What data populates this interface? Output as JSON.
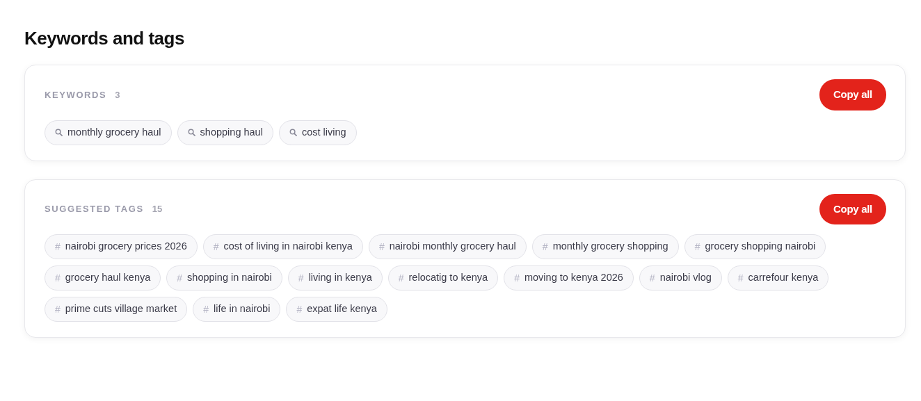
{
  "heading": "Keywords and tags",
  "sections": [
    {
      "title": "KEYWORDS",
      "count": "3",
      "button": "Copy all",
      "items": [
        {
          "kind": "search",
          "text": "monthly grocery haul"
        },
        {
          "kind": "search",
          "text": "shopping haul"
        },
        {
          "kind": "search",
          "text": "cost living"
        }
      ]
    },
    {
      "title": "SUGGESTED TAGS",
      "count": "15",
      "button": "Copy all",
      "items": [
        {
          "kind": "hash",
          "mark": "#",
          "text": "nairobi grocery prices 2026"
        },
        {
          "kind": "hash",
          "mark": "#",
          "text": "cost of living in nairobi kenya"
        },
        {
          "kind": "hash",
          "mark": "#",
          "text": "nairobi monthly grocery haul"
        },
        {
          "kind": "hash",
          "mark": "#",
          "text": "monthly grocery shopping"
        },
        {
          "kind": "hash",
          "mark": "#",
          "text": "grocery shopping nairobi"
        },
        {
          "kind": "hash",
          "mark": "#",
          "text": "grocery haul kenya"
        },
        {
          "kind": "hash",
          "mark": "#",
          "text": "shopping in nairobi"
        },
        {
          "kind": "hash",
          "mark": "#",
          "text": "living in kenya"
        },
        {
          "kind": "hash",
          "mark": "#",
          "text": "relocatig to kenya"
        },
        {
          "kind": "hash",
          "mark": "#",
          "text": "moving to kenya 2026"
        },
        {
          "kind": "hash",
          "mark": "#",
          "text": "nairobi vlog"
        },
        {
          "kind": "hash",
          "mark": "#",
          "text": "carrefour kenya"
        },
        {
          "kind": "hash",
          "mark": "#",
          "text": "prime cuts village market"
        },
        {
          "kind": "hash",
          "mark": "#",
          "text": "life in nairobi"
        },
        {
          "kind": "hash",
          "mark": "#",
          "text": "expat life kenya"
        }
      ]
    }
  ]
}
